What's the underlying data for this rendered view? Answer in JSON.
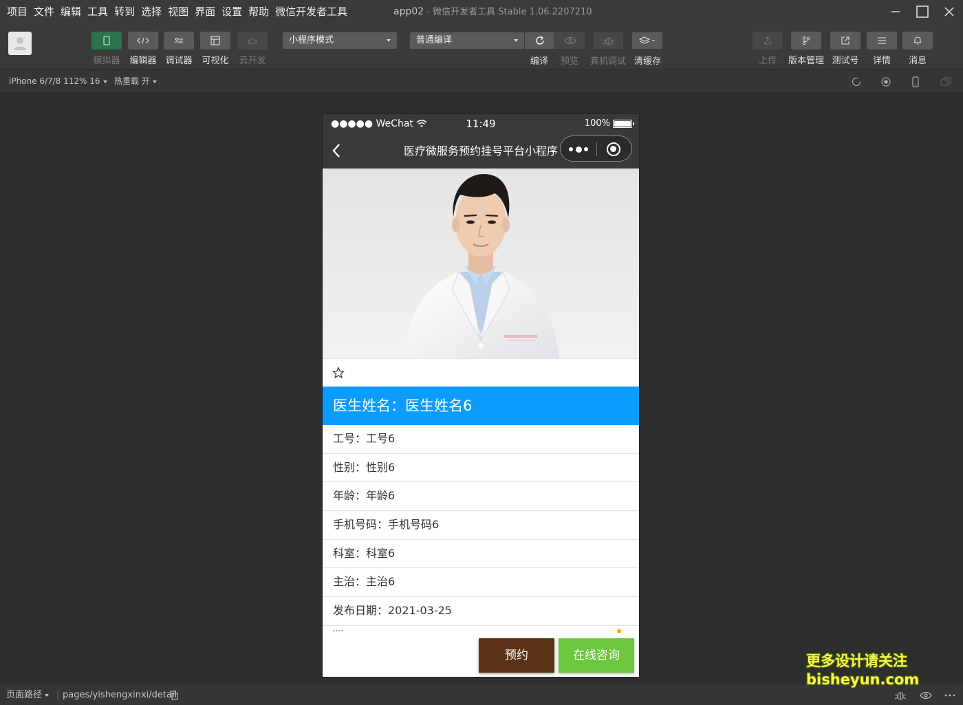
{
  "menu": {
    "items": [
      "项目",
      "文件",
      "编辑",
      "工具",
      "转到",
      "选择",
      "视图",
      "界面",
      "设置",
      "帮助",
      "微信开发者工具"
    ]
  },
  "window": {
    "app_name": "app02",
    "title_suffix": "- 微信开发者工具 Stable 1.06.2207210"
  },
  "toolbar": {
    "left_tools": [
      {
        "label": "模拟器",
        "icon": "phone-icon"
      },
      {
        "label": "编辑器",
        "icon": "code-icon"
      },
      {
        "label": "调试器",
        "icon": "sliders-icon"
      },
      {
        "label": "可视化",
        "icon": "layout-icon"
      },
      {
        "label": "云开发",
        "icon": "cloud-icon"
      }
    ],
    "mode_select": "小程序模式",
    "compile_select": "普通编译",
    "compile_label": "编译",
    "preview_label": "预览",
    "real_debug_label": "真机调试",
    "clear_cache_label": "清缓存",
    "right_tools": [
      {
        "label": "上传",
        "icon": "upload-icon"
      },
      {
        "label": "版本管理",
        "icon": "branch-icon"
      },
      {
        "label": "测试号",
        "icon": "external-link-icon"
      },
      {
        "label": "详情",
        "icon": "menu-icon"
      },
      {
        "label": "消息",
        "icon": "bell-icon"
      }
    ]
  },
  "subbar": {
    "device": "iPhone 6/7/8 112% 16",
    "hot_reload": "热重载 开"
  },
  "phone": {
    "status": {
      "carrier": "●●●●● WeChat",
      "time": "11:49",
      "battery": "100%"
    },
    "nav_title": "医疗微服务预约挂号平台小程序",
    "doctor_name_label": "医生姓名：医生姓名6",
    "fields": [
      "工号：工号6",
      "性别：性别6",
      "年龄：年龄6",
      "手机号码：手机号码6",
      "科室：科室6",
      "主治：主治6",
      "发布日期：2021-03-25"
    ],
    "book_button": "预约",
    "consult_button": "在线咨询"
  },
  "bottombar": {
    "path_label": "页面路径",
    "path": "pages/yishengxinxi/detail"
  },
  "watermark": {
    "line1": "更多设计请关注",
    "line2": "bisheyun.com"
  }
}
